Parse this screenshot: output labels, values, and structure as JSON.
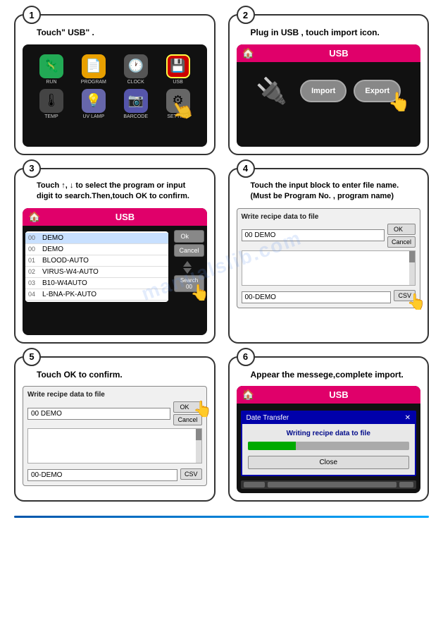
{
  "steps": [
    {
      "number": "1",
      "label": "Touch\" USB\" .",
      "icons": [
        {
          "id": "run",
          "label": "RUN",
          "emoji": "🦎",
          "class": "icon-run"
        },
        {
          "id": "program",
          "label": "PROGRAM",
          "emoji": "📄",
          "class": "icon-program"
        },
        {
          "id": "clock",
          "label": "CLOCK",
          "emoji": "🕐",
          "class": "icon-clock"
        },
        {
          "id": "usb",
          "label": "USB",
          "emoji": "💾",
          "class": "icon-usb"
        },
        {
          "id": "temp",
          "label": "TEMP",
          "emoji": "🌡",
          "class": "icon-temp"
        },
        {
          "id": "uvlamp",
          "label": "UV LAMP",
          "emoji": "💡",
          "class": "icon-uvlamp"
        },
        {
          "id": "barcode",
          "label": "BARCODE",
          "emoji": "📷",
          "class": "icon-barcode"
        },
        {
          "id": "setting",
          "label": "SETTING",
          "emoji": "⚙",
          "class": "icon-setting"
        }
      ]
    },
    {
      "number": "2",
      "label": "Plug in USB , touch import icon.",
      "usb_header": "USB",
      "import_label": "Import",
      "export_label": "Export"
    },
    {
      "number": "3",
      "label": "Touch ↑, ↓ to select the program or input\ndigit to search.Then,touch OK to confirm.",
      "usb_header": "USB",
      "list_items": [
        {
          "num": "00",
          "name": "DEMO"
        },
        {
          "num": "00",
          "name": "DEMO"
        },
        {
          "num": "01",
          "name": "BLOOD-AUTO"
        },
        {
          "num": "02",
          "name": "VIRUS-W4-AUTO"
        },
        {
          "num": "03",
          "name": "B10-W4AUTO"
        },
        {
          "num": "04",
          "name": "L-BNA-PK-AUTO"
        }
      ],
      "ok_label": "Ok",
      "cancel_label": "Cancel",
      "search_label": "Search\n00"
    },
    {
      "number": "4",
      "label": "Touch the input block to enter file name.\n(Must be Program No. , program name)",
      "dialog_title": "Write recipe data to file",
      "input_value": "00  DEMO",
      "bottom_input": "00-DEMO",
      "ok_label": "OK",
      "cancel_label": "Cancel",
      "csv_label": "CSV"
    },
    {
      "number": "5",
      "label": "Touch OK to confirm.",
      "dialog_title": "Write recipe data to file",
      "input_value": "00  DEMO",
      "bottom_input": "00-DEMO",
      "ok_label": "OK",
      "cancel_label": "Cancel",
      "csv_label": "CSV"
    },
    {
      "number": "6",
      "label": "Appear the messege,complete import.",
      "usb_header": "USB",
      "transfer_title": "Date Transfer",
      "transfer_text": "Writing recipe data to file",
      "close_label": "Close"
    }
  ]
}
